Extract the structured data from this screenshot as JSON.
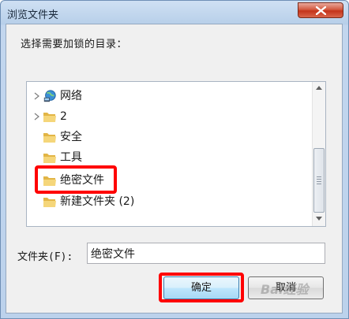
{
  "window": {
    "title": "浏览文件夹",
    "prompt": "选择需要加锁的目录："
  },
  "tree": {
    "items": [
      {
        "label": "网络",
        "icon": "network-icon",
        "expandable": true
      },
      {
        "label": "2",
        "icon": "folder-icon",
        "expandable": true
      },
      {
        "label": "安全",
        "icon": "folder-icon",
        "expandable": false
      },
      {
        "label": "工具",
        "icon": "folder-icon",
        "expandable": false
      },
      {
        "label": "绝密文件",
        "icon": "folder-icon",
        "expandable": false,
        "highlighted": true
      },
      {
        "label": "新建文件夹 (2)",
        "icon": "folder-icon",
        "expandable": false
      }
    ]
  },
  "folder": {
    "label": "文件夹(F):",
    "value": "绝密文件"
  },
  "buttons": {
    "ok": "确定",
    "cancel": "取消"
  },
  "watermark": "Bai经验",
  "colors": {
    "highlight": "#ff0000",
    "folder": "#e8c35a"
  }
}
